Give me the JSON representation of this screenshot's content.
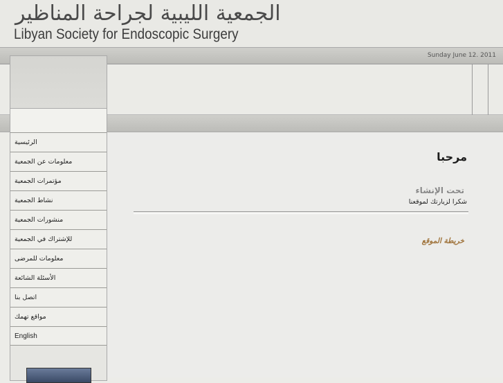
{
  "header": {
    "title_ar": "الجمعية الليبية لجراحة المناظير",
    "title_en": "Libyan Society for Endoscopic Surgery",
    "date": "Sunday June 12. 2011"
  },
  "sidebar": {
    "items": [
      {
        "label": "الرئيسية"
      },
      {
        "label": "معلومات عن الجمعية"
      },
      {
        "label": "مؤتمرات الجمعية"
      },
      {
        "label": "نشاط الجمعية"
      },
      {
        "label": "منشورات الجمعية"
      },
      {
        "label": "للإشتراك في الجمعية"
      },
      {
        "label": "معلومات للمرضى"
      },
      {
        "label": "الأسئلة الشائعة"
      },
      {
        "label": "اتصل بنا"
      },
      {
        "label": "مواقع تهمك"
      },
      {
        "label": "English"
      }
    ]
  },
  "main": {
    "welcome": "مرحبا",
    "under_construction": "تحت الإنشاء",
    "thanks": "شكرا لزيارتك لموقعنا",
    "sitemap": "خريطة الموقع"
  }
}
